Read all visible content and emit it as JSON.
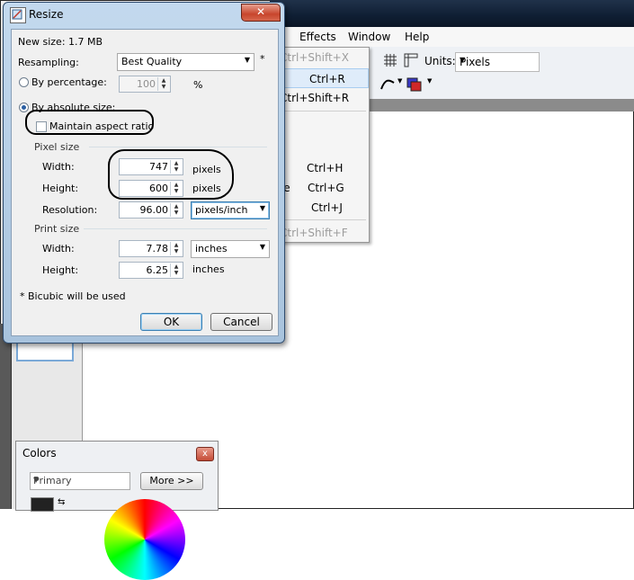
{
  "app": {
    "menu": [
      "Effects",
      "Window",
      "Help"
    ],
    "units_label": "Units:",
    "units_value": "Pixels"
  },
  "dropdown": [
    {
      "left": "Ctrl+Shift+X",
      "grey": true
    },
    {
      "left": "Ctrl+R",
      "highlight": true
    },
    {
      "left": "Ctrl+Shift+R"
    },
    {
      "left": "Ctrl+H"
    },
    {
      "prefix": "se",
      "left": "Ctrl+G"
    },
    {
      "left": "Ctrl+J"
    },
    {
      "left": "Ctrl+Shift+F",
      "grey": true
    }
  ],
  "dialog": {
    "title": "Resize",
    "close": "✕",
    "new_size": "New size: 1.7 MB",
    "resampling_label": "Resampling:",
    "resampling_value": "Best Quality",
    "resampling_note": "*",
    "by_percentage": "By percentage:",
    "percentage_value": "100",
    "percent_sign": "%",
    "by_absolute": "By absolute size:",
    "maintain_aspect": "Maintain aspect ratio",
    "pixel_size": "Pixel size",
    "width_label": "Width:",
    "width_px": "747",
    "height_label": "Height:",
    "height_px": "600",
    "pixels": "pixels",
    "resolution_label": "Resolution:",
    "resolution_value": "96.00",
    "resolution_unit": "pixels/inch",
    "print_size": "Print size",
    "print_width": "7.78",
    "print_width_unit": "inches",
    "print_height": "6.25",
    "print_height_unit": "inches",
    "footnote": "* Bicubic will be used",
    "ok": "OK",
    "cancel": "Cancel"
  },
  "colors": {
    "title": "Colors",
    "close": "x",
    "select_value": "Primary",
    "more": "More >>"
  }
}
